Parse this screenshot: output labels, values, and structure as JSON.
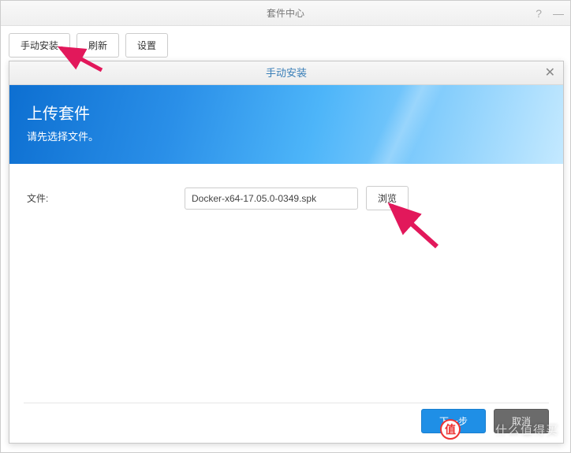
{
  "window": {
    "title": "套件中心",
    "help_icon": "?",
    "minimize_icon": "—"
  },
  "toolbar": {
    "manual_install": "手动安装",
    "refresh": "刷新",
    "settings": "设置"
  },
  "dialog": {
    "title": "手动安装",
    "close": "✕",
    "banner_title": "上传套件",
    "banner_sub": "请先选择文件。",
    "file_label": "文件:",
    "file_value": "Docker-x64-17.05.0-0349.spk",
    "browse": "浏览",
    "next": "下一步",
    "cancel": "取消"
  },
  "watermark": {
    "badge": "值",
    "text": "什么值得买"
  }
}
